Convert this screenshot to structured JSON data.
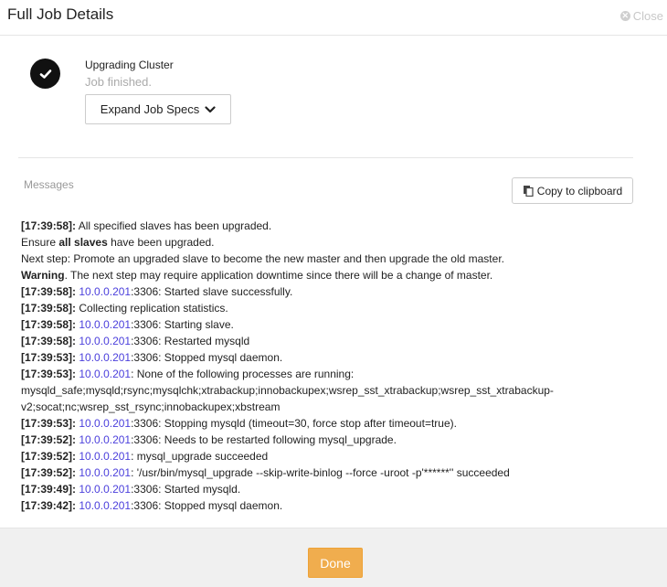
{
  "header": {
    "title": "Full Job Details",
    "close_label": "Close",
    "close_icon": "x-circle-icon"
  },
  "job": {
    "status_icon": "check-circle-icon",
    "title": "Upgrading Cluster",
    "status_text": "Job finished.",
    "expand_label": "Expand Job Specs",
    "expand_icon": "chevron-down-icon"
  },
  "messages": {
    "label": "Messages",
    "copy_label": "Copy to clipboard",
    "copy_icon": "clipboard-icon",
    "lines": [
      {
        "ts": "[17:39:58]:",
        "parts": [
          {
            "t": " All specified slaves has been upgraded."
          }
        ]
      },
      {
        "ts": "",
        "parts": [
          {
            "t": "Ensure "
          },
          {
            "t": "all slaves",
            "b": true
          },
          {
            "t": " have been upgraded."
          }
        ]
      },
      {
        "ts": "",
        "parts": [
          {
            "t": "Next step: Promote an upgraded slave to become the new master and then upgrade the old master."
          }
        ]
      },
      {
        "ts": "",
        "parts": [
          {
            "t": "Warning",
            "b": true
          },
          {
            "t": ". The next step may require application downtime since there will be a change of master."
          }
        ]
      },
      {
        "ts": "[17:39:58]:",
        "parts": [
          {
            "t": " "
          },
          {
            "t": "10.0.0.201",
            "h": true
          },
          {
            "t": ":3306: Started slave successfully."
          }
        ]
      },
      {
        "ts": "[17:39:58]:",
        "parts": [
          {
            "t": " Collecting replication statistics."
          }
        ]
      },
      {
        "ts": "[17:39:58]:",
        "parts": [
          {
            "t": " "
          },
          {
            "t": "10.0.0.201",
            "h": true
          },
          {
            "t": ":3306: Starting slave."
          }
        ]
      },
      {
        "ts": "[17:39:58]:",
        "parts": [
          {
            "t": " "
          },
          {
            "t": "10.0.0.201",
            "h": true
          },
          {
            "t": ":3306: Restarted mysqld"
          }
        ]
      },
      {
        "ts": "[17:39:53]:",
        "parts": [
          {
            "t": " "
          },
          {
            "t": "10.0.0.201",
            "h": true
          },
          {
            "t": ":3306: Stopped mysql daemon."
          }
        ]
      },
      {
        "ts": "[17:39:53]:",
        "parts": [
          {
            "t": " "
          },
          {
            "t": "10.0.0.201",
            "h": true
          },
          {
            "t": ": None of the following processes are running: mysqld_safe;mysqld;rsync;mysqlchk;xtrabackup;innobackupex;wsrep_sst_xtrabackup;wsrep_sst_xtrabackup-v2;socat;nc;wsrep_sst_rsync;innobackupex;xbstream"
          }
        ]
      },
      {
        "ts": "[17:39:53]:",
        "parts": [
          {
            "t": " "
          },
          {
            "t": "10.0.0.201",
            "h": true
          },
          {
            "t": ":3306: Stopping mysqld (timeout=30, force stop after timeout=true)."
          }
        ]
      },
      {
        "ts": "[17:39:52]:",
        "parts": [
          {
            "t": " "
          },
          {
            "t": "10.0.0.201",
            "h": true
          },
          {
            "t": ":3306: Needs to be restarted following mysql_upgrade."
          }
        ]
      },
      {
        "ts": "[17:39:52]:",
        "parts": [
          {
            "t": " "
          },
          {
            "t": "10.0.0.201",
            "h": true
          },
          {
            "t": ": mysql_upgrade succeeded"
          }
        ]
      },
      {
        "ts": "[17:39:52]:",
        "parts": [
          {
            "t": " "
          },
          {
            "t": "10.0.0.201",
            "h": true
          },
          {
            "t": ": '/usr/bin/mysql_upgrade --skip-write-binlog --force -uroot -p'******'' succeeded"
          }
        ]
      },
      {
        "ts": "[17:39:49]:",
        "parts": [
          {
            "t": " "
          },
          {
            "t": "10.0.0.201",
            "h": true
          },
          {
            "t": ":3306: Started mysqld."
          }
        ]
      },
      {
        "ts": "[17:39:42]:",
        "parts": [
          {
            "t": " "
          },
          {
            "t": "10.0.0.201",
            "h": true
          },
          {
            "t": ":3306: Stopped mysql daemon."
          }
        ]
      }
    ]
  },
  "footer": {
    "done_label": "Done"
  },
  "colors": {
    "host_link": "#4b3fdc",
    "done_button": "#f0ad4e",
    "footer_bg": "#f0f0f0"
  }
}
